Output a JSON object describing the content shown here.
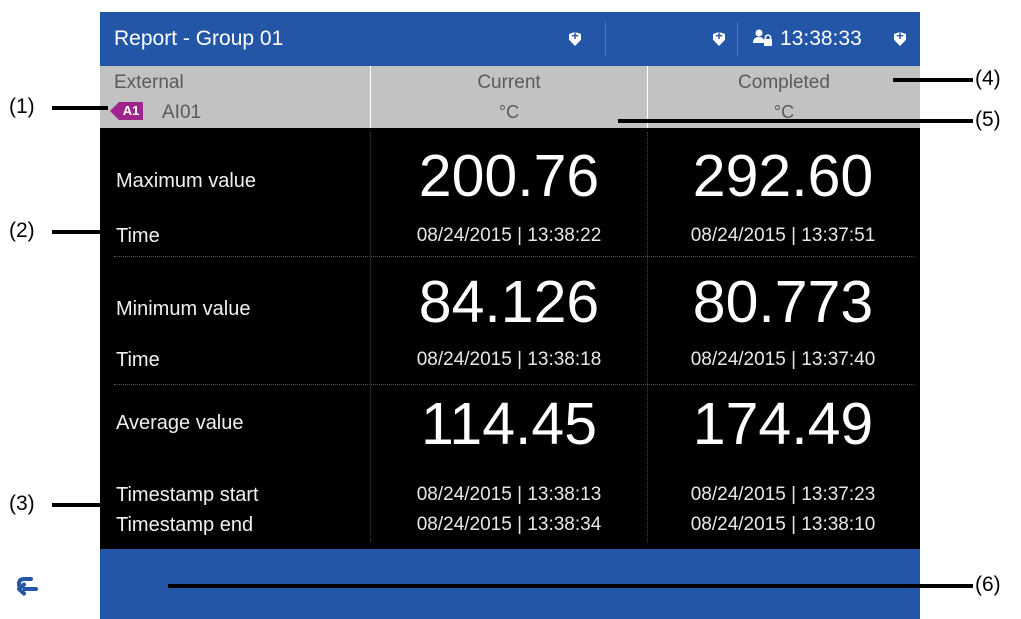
{
  "titlebar": {
    "title": "Report - Group 01",
    "time": "13:38:33",
    "icons": [
      "shield-plus-icon",
      "shield-plus-icon",
      "user-lock-icon",
      "shield-plus-icon"
    ]
  },
  "header": {
    "columns": [
      {
        "name": "External",
        "badge": "A1",
        "value": "AI01"
      },
      {
        "name": "Current",
        "unit": "°C"
      },
      {
        "name": "Completed",
        "unit": "°C"
      }
    ]
  },
  "rows": {
    "max": {
      "label": "Maximum value",
      "time_label": "Time",
      "current_value": "200.76",
      "current_time": "08/24/2015 | 13:38:22",
      "completed_value": "292.60",
      "completed_time": "08/24/2015 | 13:37:51"
    },
    "min": {
      "label": "Minimum value",
      "time_label": "Time",
      "current_value": "84.126",
      "current_time": "08/24/2015 | 13:38:18",
      "completed_value": "80.773",
      "completed_time": "08/24/2015 | 13:37:40"
    },
    "avg": {
      "label": "Average value",
      "start_label": "Timestamp start",
      "end_label": "Timestamp end",
      "current_value": "114.45",
      "current_start": "08/24/2015 | 13:38:13",
      "current_end": "08/24/2015 | 13:38:34",
      "completed_value": "174.49",
      "completed_start": "08/24/2015 | 13:37:23",
      "completed_end": "08/24/2015 | 13:38:10"
    }
  },
  "callouts": [
    "(1)",
    "(2)",
    "(3)",
    "(4)",
    "(5)",
    "(6)"
  ],
  "colors": {
    "titlebar": "#2356a6",
    "header": "#c2c2c2",
    "badge": "#a0238e",
    "body": "#000000"
  }
}
